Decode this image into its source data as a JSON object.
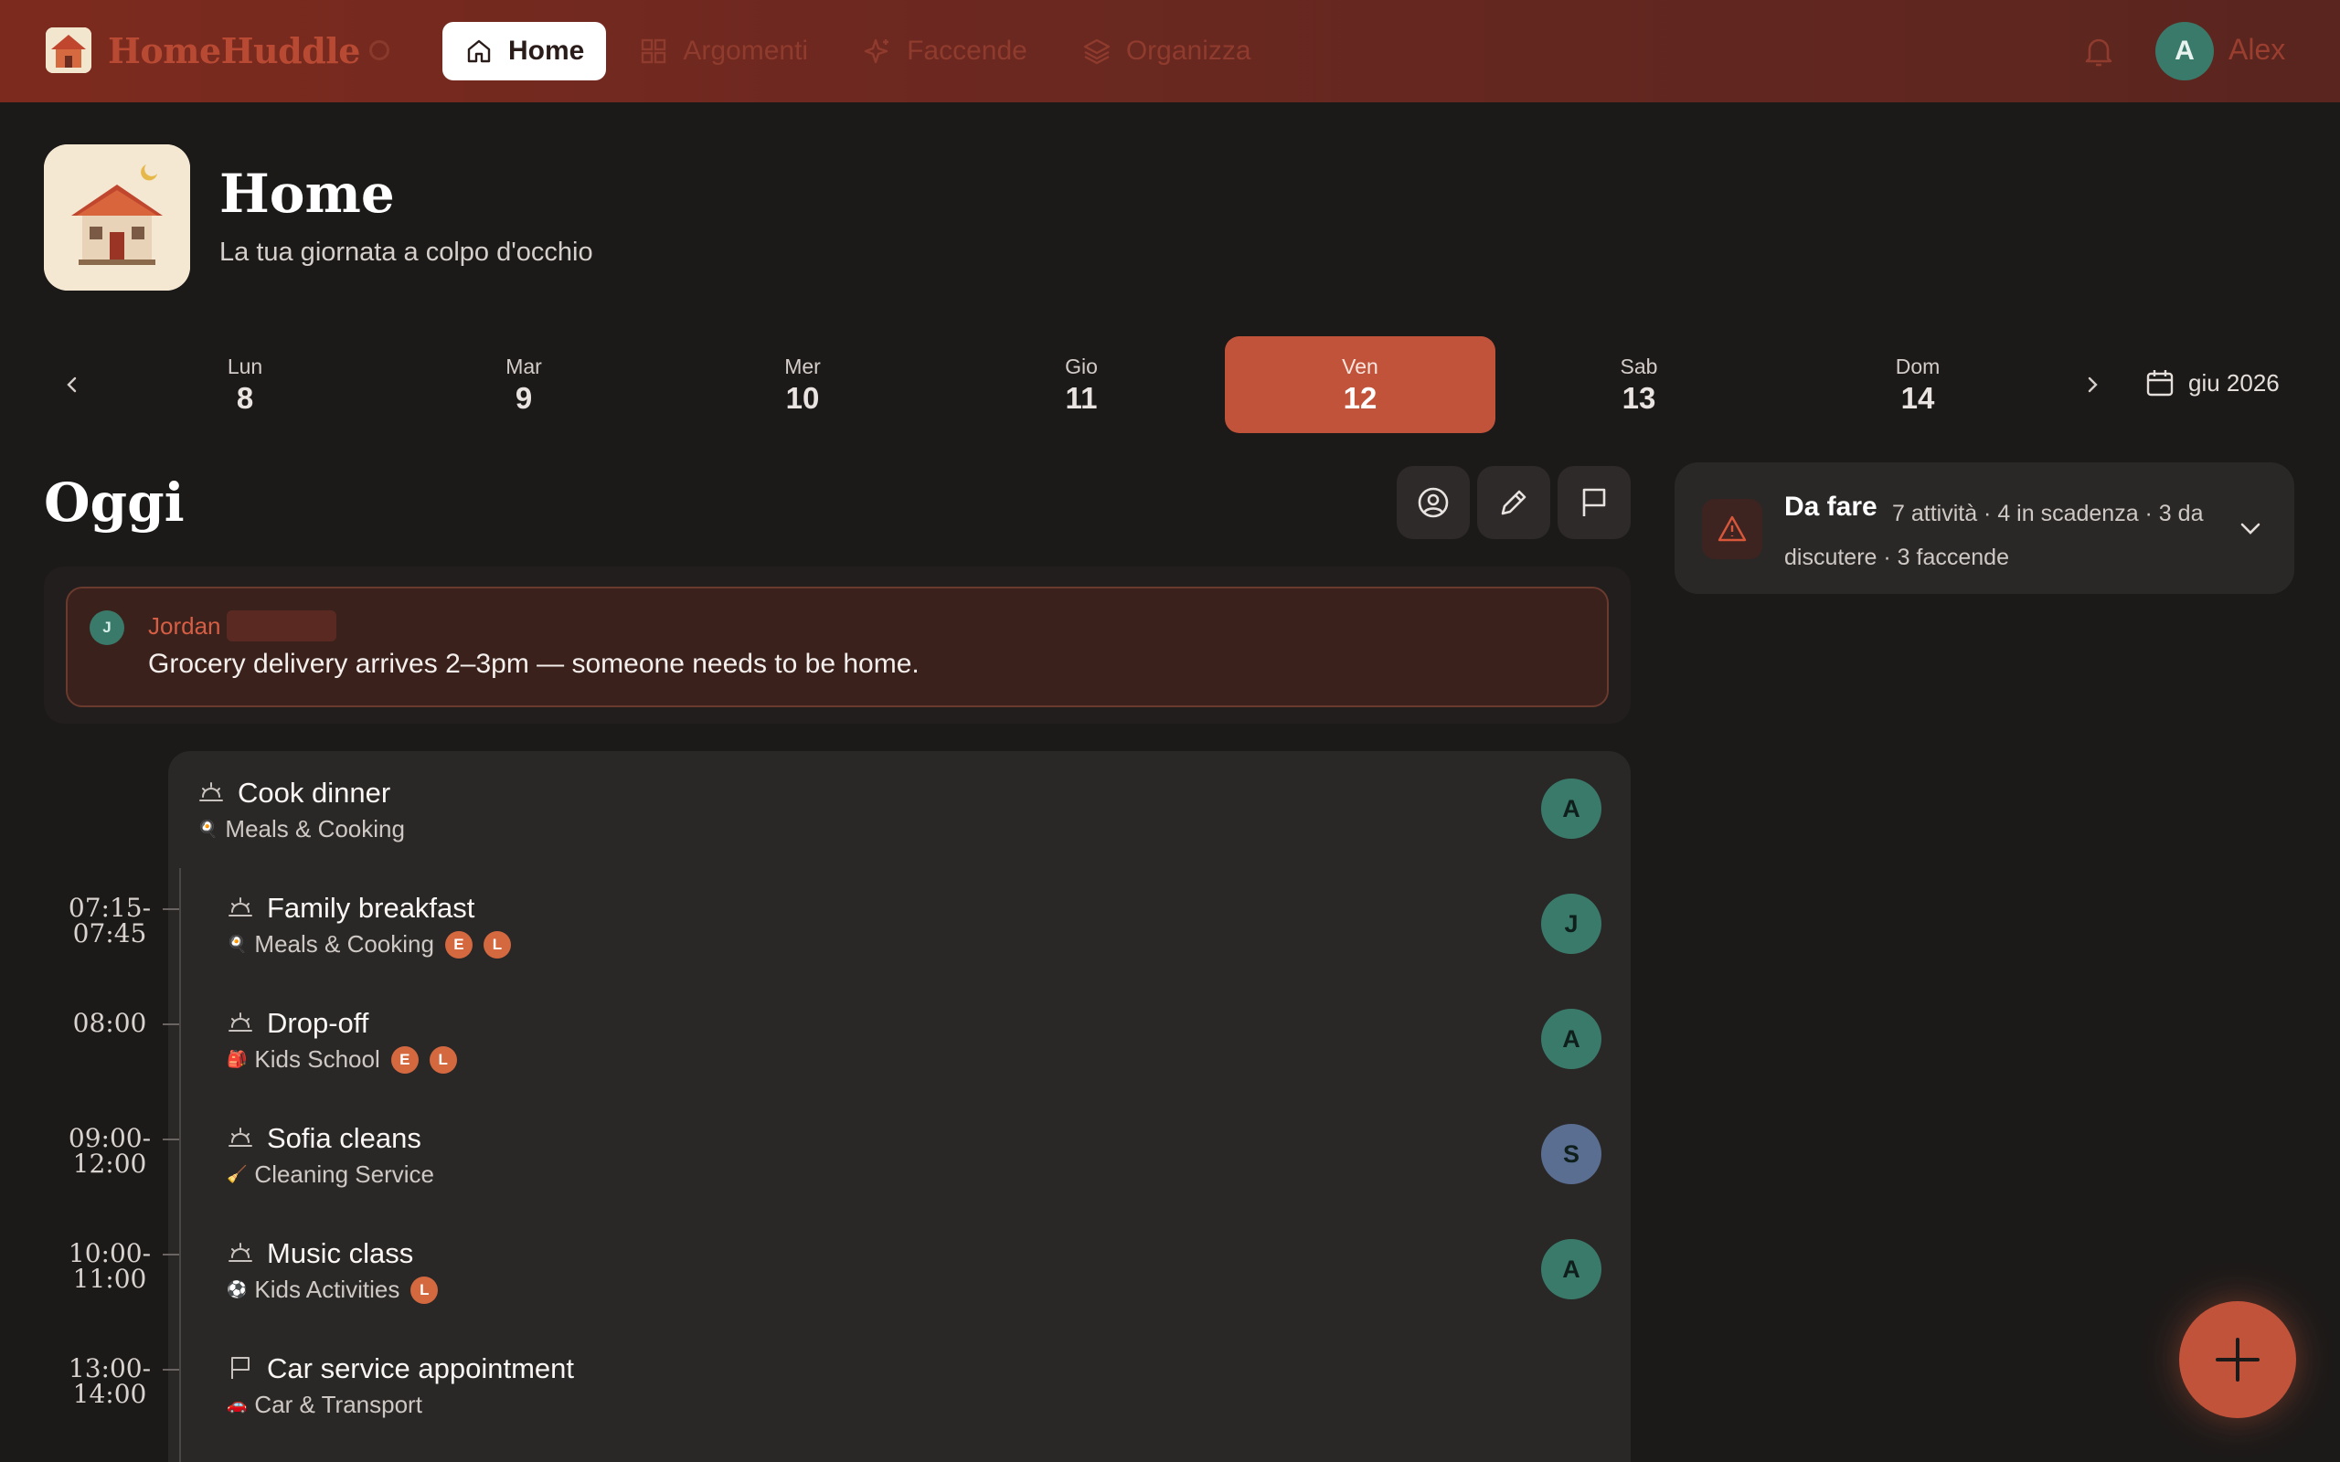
{
  "app": {
    "name": "HomeHuddle"
  },
  "nav": {
    "items": [
      {
        "label": "Home",
        "icon": "home-icon",
        "active": true
      },
      {
        "label": "Argomenti",
        "icon": "grid-icon",
        "active": false
      },
      {
        "label": "Faccende",
        "icon": "sparkle-icon",
        "active": false
      },
      {
        "label": "Organizza",
        "icon": "layers-icon",
        "active": false
      }
    ]
  },
  "user": {
    "initial": "A",
    "name": "Alex"
  },
  "header": {
    "title": "Home",
    "subtitle": "La tua giornata a colpo d'occhio"
  },
  "week": {
    "days": [
      {
        "name": "Lun",
        "num": "8"
      },
      {
        "name": "Mar",
        "num": "9"
      },
      {
        "name": "Mer",
        "num": "10"
      },
      {
        "name": "Gio",
        "num": "11"
      },
      {
        "name": "Ven",
        "num": "12",
        "selected": true
      },
      {
        "name": "Sab",
        "num": "13"
      },
      {
        "name": "Dom",
        "num": "14"
      }
    ],
    "month_label": "giu 2026"
  },
  "today": {
    "title": "Oggi"
  },
  "note": {
    "author_initial": "J",
    "author": "Jordan",
    "text": "Grocery delivery arrives 2–3pm — someone needs to be home."
  },
  "events": [
    {
      "title": "Cook dinner",
      "category": "Meals & Cooking",
      "cat_glyph": "🍳",
      "time_start": "",
      "time_end": "",
      "assignee": "A",
      "assignee_color": "#3a7a6a",
      "badges": [],
      "icon": "sunrise-icon"
    },
    {
      "title": "Family breakfast",
      "category": "Meals & Cooking",
      "cat_glyph": "🍳",
      "time_start": "07:15-",
      "time_end": "07:45",
      "assignee": "J",
      "assignee_color": "#3a7a6a",
      "badges": [
        "E",
        "L"
      ],
      "icon": "sunrise-icon"
    },
    {
      "title": "Drop-off",
      "category": "Kids School",
      "cat_glyph": "🎒",
      "time_start": "08:00",
      "time_end": "",
      "assignee": "A",
      "assignee_color": "#3a7a6a",
      "badges": [
        "E",
        "L"
      ],
      "icon": "sunrise-icon"
    },
    {
      "title": "Sofia cleans",
      "category": "Cleaning Service",
      "cat_glyph": "🧹",
      "time_start": "09:00-",
      "time_end": "12:00",
      "assignee": "S",
      "assignee_color": "#5a6e92",
      "badges": [],
      "icon": "sunrise-icon"
    },
    {
      "title": "Music class",
      "category": "Kids Activities",
      "cat_glyph": "⚽",
      "time_start": "10:00-",
      "time_end": "11:00",
      "assignee": "A",
      "assignee_color": "#3a7a6a",
      "badges": [
        "L"
      ],
      "icon": "sunrise-icon"
    },
    {
      "title": "Car service appointment",
      "category": "Car & Transport",
      "cat_glyph": "🚗",
      "time_start": "13:00-",
      "time_end": "14:00",
      "assignee": "",
      "assignee_color": "",
      "badges": [],
      "icon": "flag-icon"
    }
  ],
  "todo": {
    "title": "Da fare",
    "summary": "7 attività · 4 in scadenza · 3 da discutere · 3 faccende"
  },
  "colors": {
    "accent": "#c2533b",
    "topbar": "#6a2820",
    "background": "#1c1a19",
    "card": "#2a2827",
    "badge": "#d4683f"
  }
}
